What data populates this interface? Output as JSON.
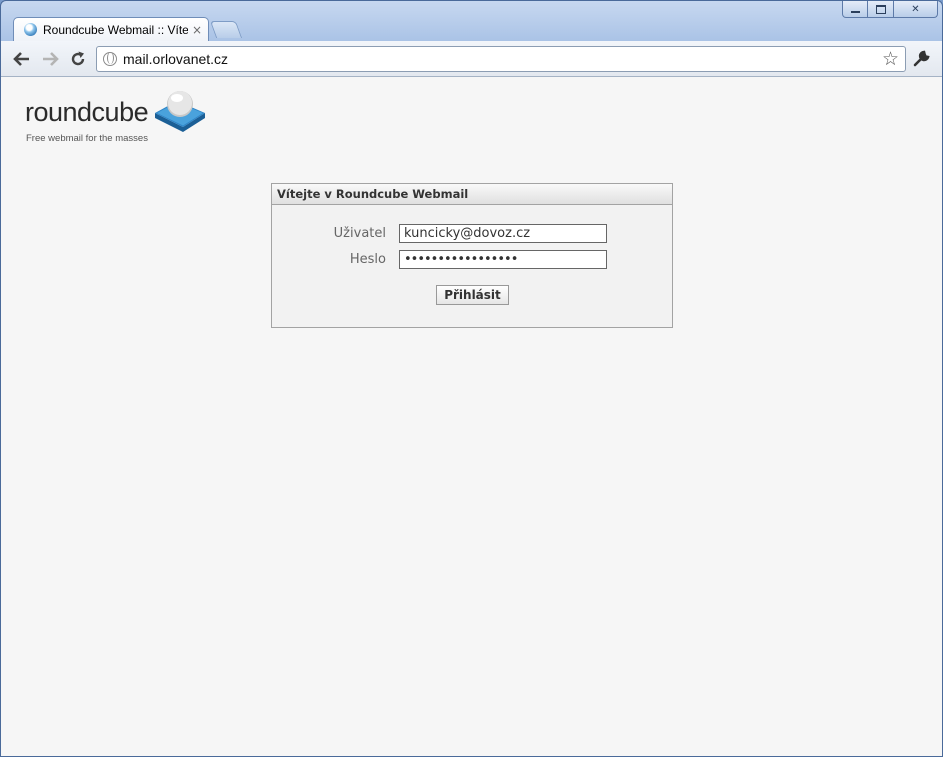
{
  "browser": {
    "tab_title": "Roundcube Webmail :: Vítejte",
    "tab_close": "×",
    "url": "mail.orlovanet.cz",
    "window_controls": {
      "close": "✕"
    }
  },
  "logo": {
    "name": "roundcube",
    "tagline": "Free webmail for the masses"
  },
  "login": {
    "title": "Vítejte v Roundcube Webmail",
    "user_label": "Uživatel",
    "user_value": "kuncicky@dovoz.cz",
    "password_label": "Heslo",
    "password_value": "•••••••••••••••••",
    "submit_label": "Přihlásit"
  },
  "colors": {
    "page_background": "#f6f6f6",
    "logo_blue": "#2f86c8"
  }
}
